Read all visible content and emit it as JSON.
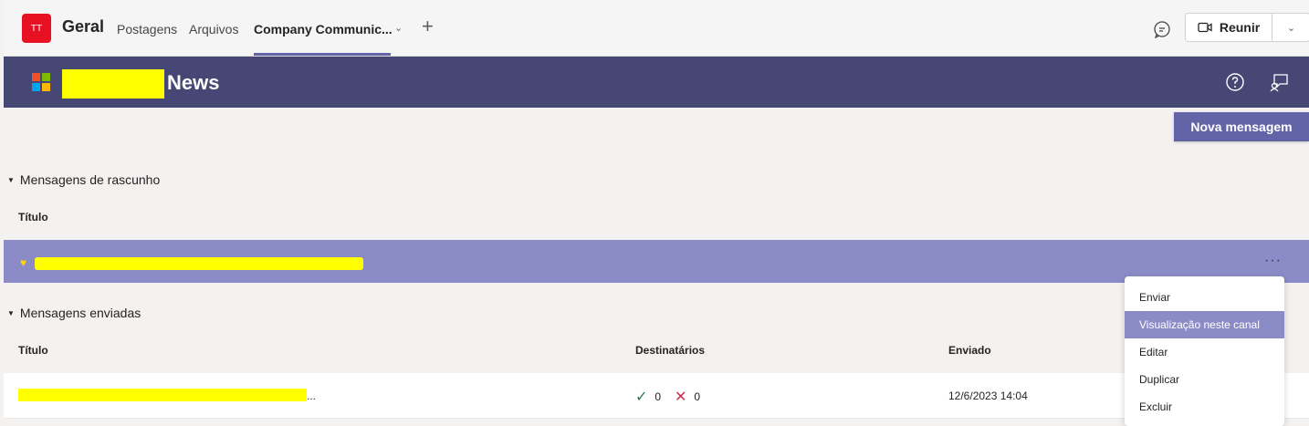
{
  "topbar": {
    "team_initials": "TT",
    "team_name": "Geral",
    "tabs": [
      "Postagens",
      "Arquivos",
      "Company Communic..."
    ],
    "meet_label": "Reunir"
  },
  "app": {
    "title": "News",
    "new_message_label": "Nova mensagem"
  },
  "drafts": {
    "section_label": "Mensagens de rascunho",
    "col_title": "Título"
  },
  "sent": {
    "section_label": "Mensagens enviadas",
    "col_title": "Título",
    "col_recipients": "Destinatários",
    "col_sent": "Enviado",
    "row": {
      "title_suffix": "...",
      "success_count": "0",
      "fail_count": "0",
      "sent_date": "12/6/2023 14:04"
    }
  },
  "context_menu": {
    "items": [
      "Enviar",
      "Visualização neste canal",
      "Editar",
      "Duplicar",
      "Excluir"
    ],
    "active_index": 1
  },
  "colors": {
    "brand": "#6264a7",
    "header": "#464775",
    "selected_row": "#8b8cc7",
    "redaction": "#ffff00"
  }
}
